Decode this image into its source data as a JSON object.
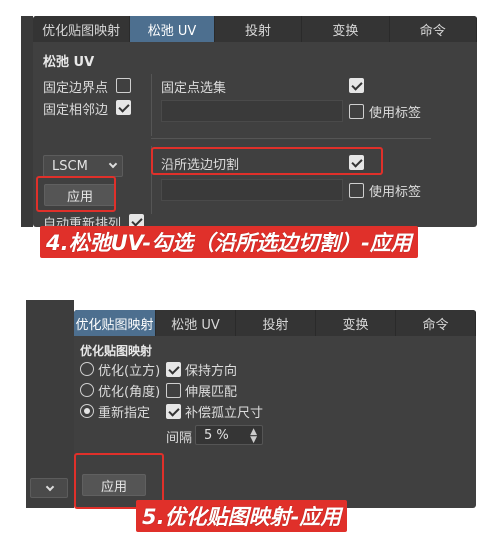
{
  "panel1": {
    "tabs": [
      "优化贴图映射",
      "松弛 UV",
      "投射",
      "变换",
      "命令"
    ],
    "active_tab": 1,
    "section_title": "松弛 UV",
    "fix_boundary_label": "固定边界点",
    "fix_neighbor_label": "固定相邻边",
    "fixed_selection_label": "固定点选集",
    "use_tags_label": "使用标签",
    "cut_along_selection_label": "沿所选边切割",
    "use_tags_label2": "使用标签",
    "method_select": "LSCM",
    "apply_button": "应用",
    "auto_realign_label": "自动重新排列",
    "checkbox_states": {
      "fix_boundary": false,
      "fix_neighbor": true,
      "fixed_selection": true,
      "use_tags": false,
      "cut_along": true,
      "use_tags2": false,
      "auto_realign": true
    }
  },
  "caption1": "4.松弛UV-勾选（沿所选边切割）-应用",
  "panel2": {
    "tabs": [
      "优化贴图映射",
      "松弛 UV",
      "投射",
      "变换",
      "命令"
    ],
    "active_tab": 0,
    "section_title": "优化贴图映射",
    "radio_options": [
      "优化(立方)",
      "优化(角度)",
      "重新指定"
    ],
    "selected_radio": 2,
    "keep_orientation_label": "保持方向",
    "stretch_fit_label": "伸展匹配",
    "equalize_islands_label": "补偿孤立尺寸",
    "spacing_label": "间隔",
    "spacing_value": "5 %",
    "apply_button": "应用",
    "checkbox_states": {
      "keep_orientation": true,
      "stretch_fit": false,
      "equalize_islands": true
    }
  },
  "caption2": "5.优化贴图映射-应用",
  "colors": {
    "panel_bg": "#404040",
    "tab_active": "#4d6f8f",
    "highlight_red": "#e0302a"
  }
}
